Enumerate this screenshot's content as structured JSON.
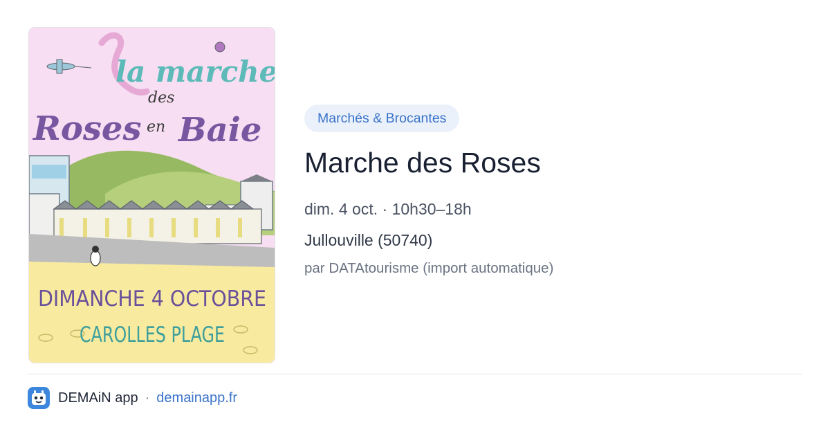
{
  "poster": {
    "line1": "la marche",
    "line2": "des",
    "line3": "Roses",
    "line4": "en",
    "line5": "Baie",
    "date_line": "DIMANCHE 4 OCTOBRE",
    "place_line": "CAROLLES PLAGE"
  },
  "event": {
    "category": "Marchés & Brocantes",
    "title": "Marche des Roses",
    "datetime": "dim. 4 oct. · 10h30–18h",
    "location": "Jullouville (50740)",
    "source": "par DATAtourisme (import automatique)"
  },
  "footer": {
    "app_name": "DEMAiN app",
    "separator": "·",
    "site": "demainapp.fr"
  },
  "colors": {
    "accent": "#3a73c9",
    "tag_bg": "#eaf1fb",
    "title": "#182032",
    "poster_sky": "#f7def2",
    "poster_sand": "#f8eb9f",
    "poster_purple": "#7a55a0",
    "poster_teal": "#4fb6b5"
  }
}
